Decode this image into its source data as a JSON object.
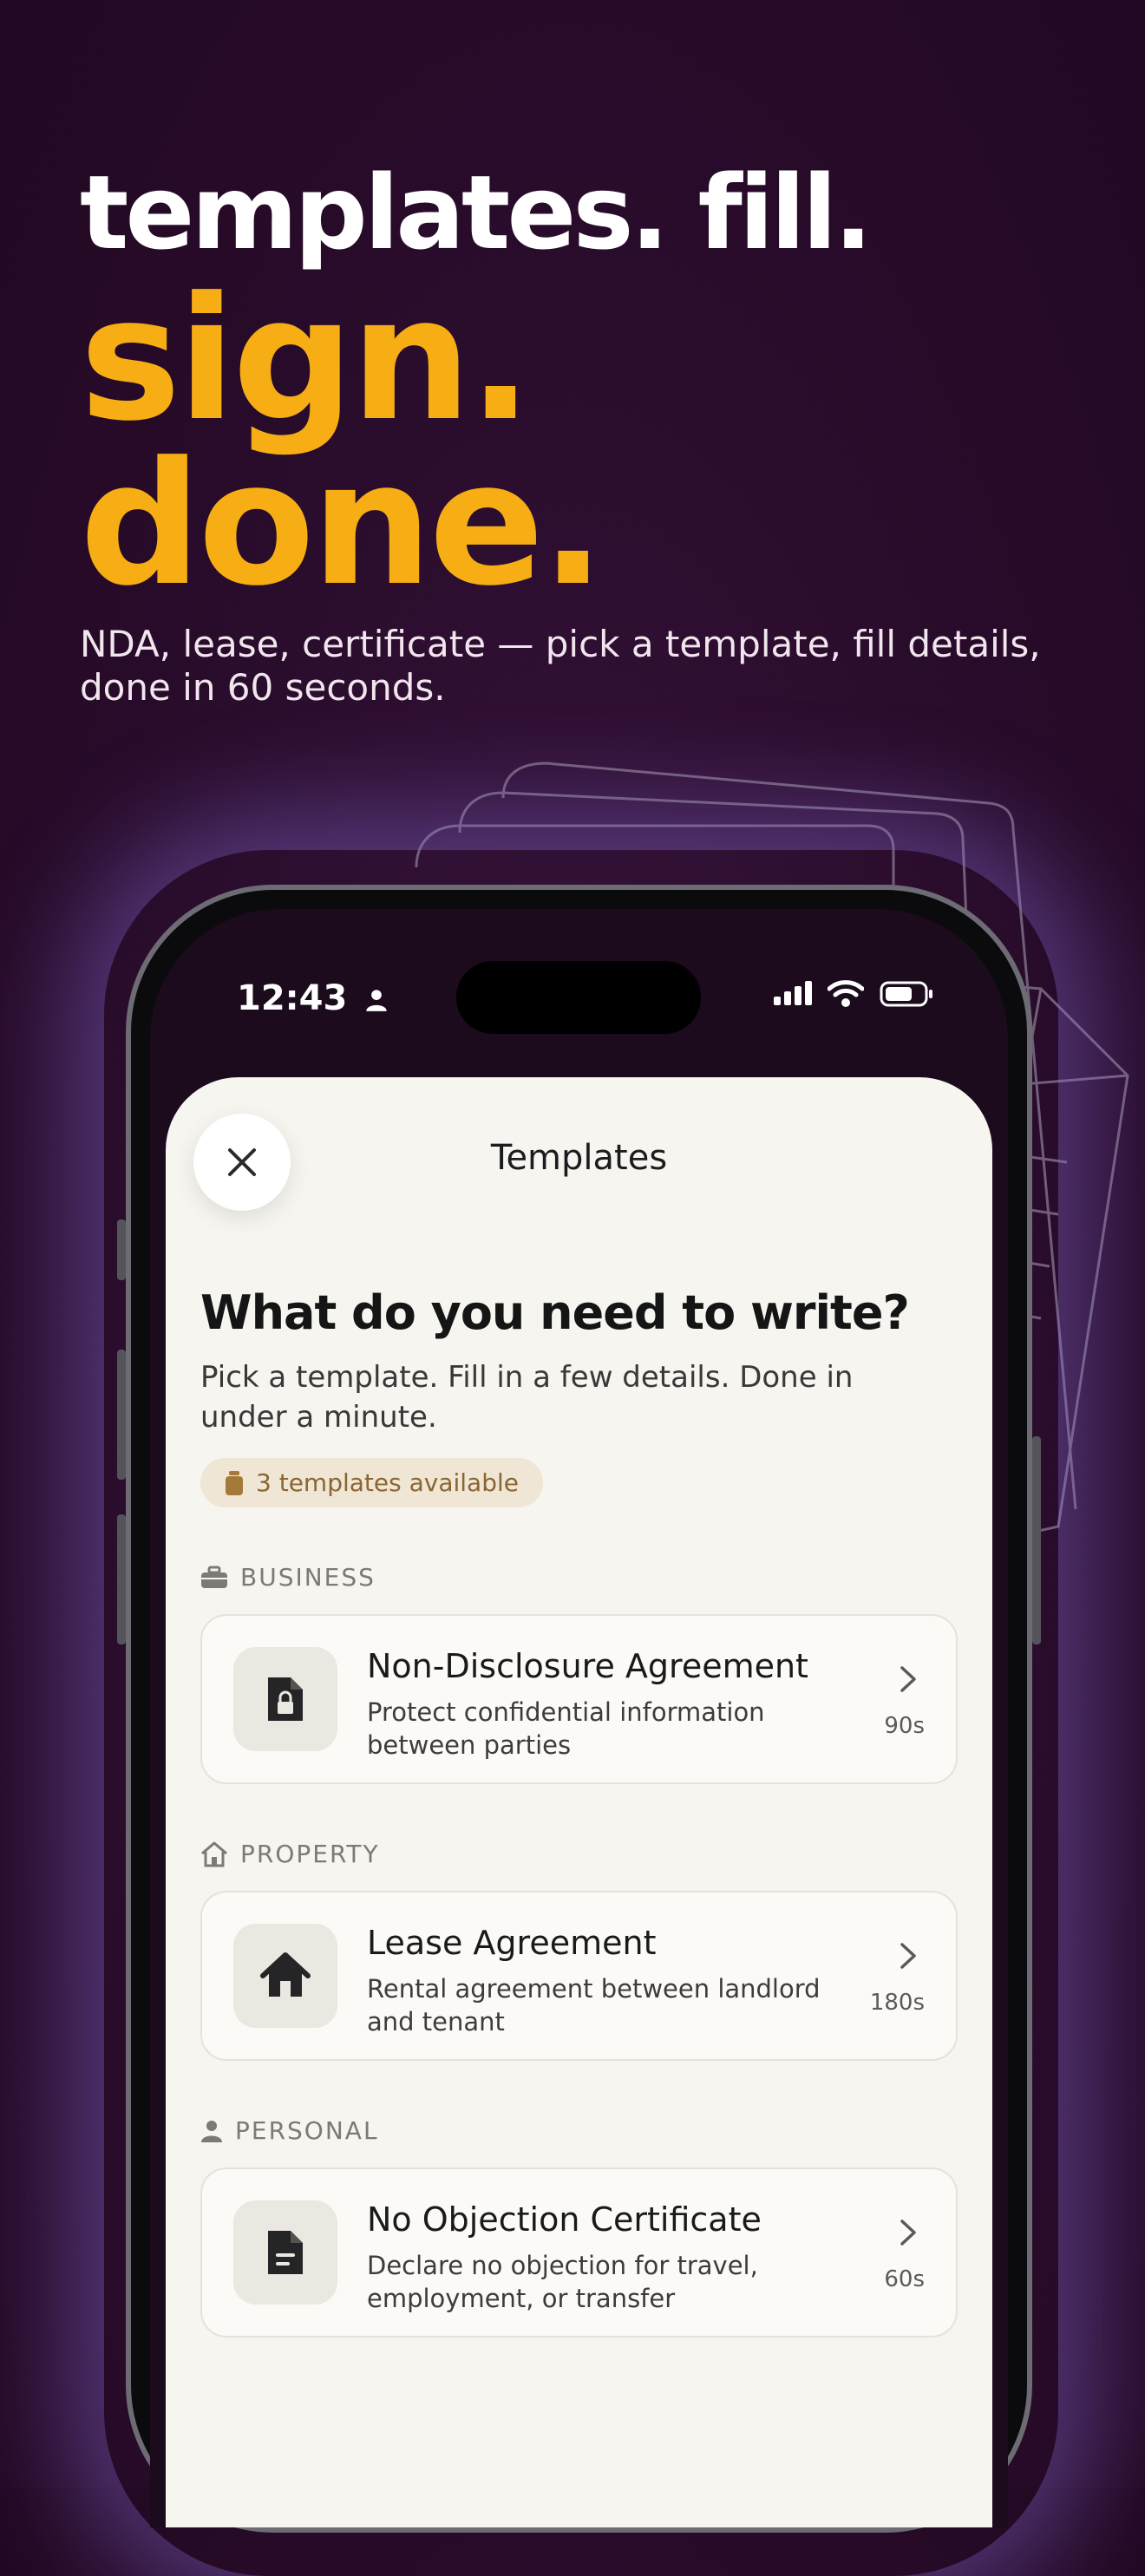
{
  "hero": {
    "line1": "templates. fill.",
    "line2": "sign.",
    "line3": "done.",
    "tagline": "NDA, lease, certificate — pick a template, fill details, done in 60 seconds."
  },
  "colors": {
    "background": "#2a0c2c",
    "accent": "#f7ad14",
    "sheet": "#f7f5f0",
    "badge_text": "#8a6632"
  },
  "status_bar": {
    "time": "12:43",
    "icons": [
      "person-icon",
      "cellular-icon",
      "wifi-icon",
      "battery-icon"
    ]
  },
  "sheet": {
    "title": "Templates",
    "close_icon": "close-icon",
    "heading": "What do you need to write?",
    "subtitle": "Pick a template. Fill in a few details. Done in under a minute.",
    "badge": "3 templates available"
  },
  "sections": [
    {
      "label": "BUSINESS",
      "icon": "briefcase-icon",
      "card": {
        "title": "Non-Disclosure Agreement",
        "description": "Protect confidential information between parties",
        "duration": "90s",
        "icon": "locked-document-icon"
      }
    },
    {
      "label": "PROPERTY",
      "icon": "house-icon",
      "card": {
        "title": "Lease Agreement",
        "description": "Rental agreement between landlord and tenant",
        "duration": "180s",
        "icon": "house-icon"
      }
    },
    {
      "label": "PERSONAL",
      "icon": "person-icon",
      "card": {
        "title": "No Objection Certificate",
        "description": "Declare no objection for travel, employment, or transfer",
        "duration": "60s",
        "icon": "document-icon"
      }
    }
  ]
}
